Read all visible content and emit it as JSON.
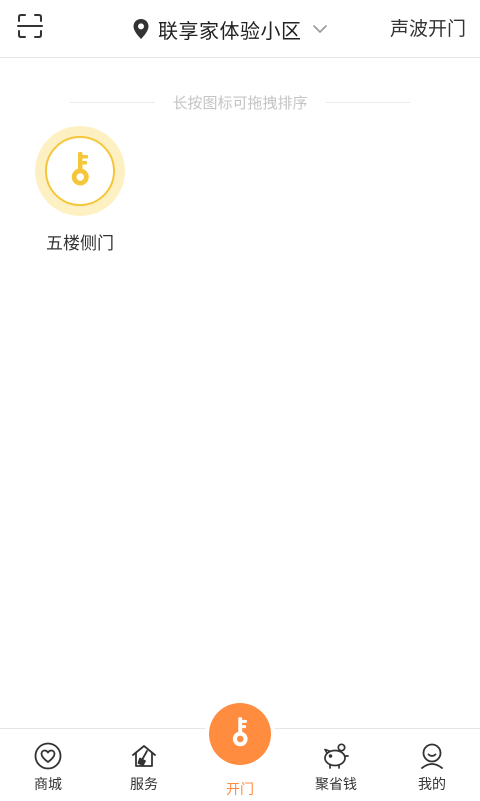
{
  "header": {
    "community_name": "联享家体验小区",
    "sonic_open_label": "声波开门"
  },
  "hint": {
    "text": "长按图标可拖拽排序"
  },
  "doors": [
    {
      "label": "五楼侧门"
    }
  ],
  "tabs": [
    {
      "label": "商城"
    },
    {
      "label": "服务"
    },
    {
      "label": "开门"
    },
    {
      "label": "聚省钱"
    },
    {
      "label": "我的"
    }
  ],
  "colors": {
    "accent_orange": "#ff8c3f",
    "key_yellow": "#f6c63a",
    "halo_yellow": "#fdf1c4",
    "hint_gray": "#c4c4c4"
  },
  "icons": {
    "scan": "scan-icon",
    "location": "location-pin-icon",
    "dropdown": "chevron-down-icon",
    "door_key": "key-icon",
    "mall": "heart-icon",
    "service": "house-broom-icon",
    "open_door": "key-icon",
    "save_money": "piggy-bank-icon",
    "mine": "user-icon"
  }
}
